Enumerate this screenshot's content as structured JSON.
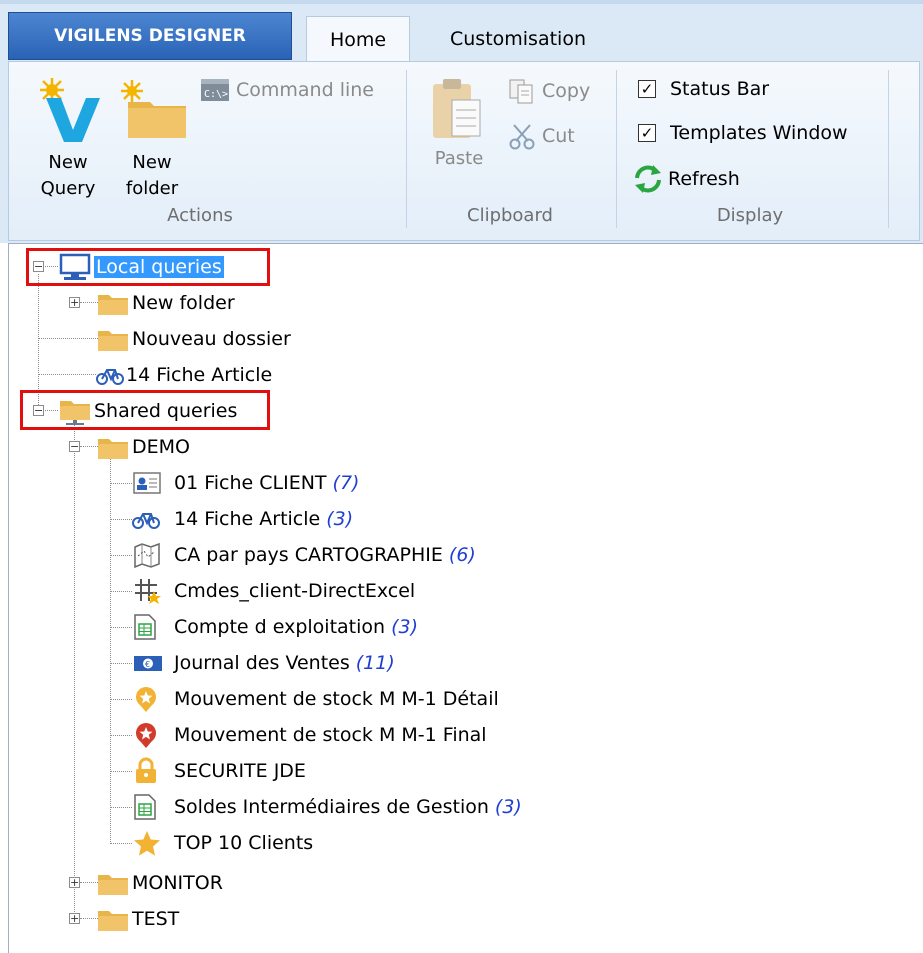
{
  "ribbon": {
    "app_tab": "VIGILENS DESIGNER",
    "tabs": [
      {
        "label": "Home",
        "active": true
      },
      {
        "label": "Customisation",
        "active": false
      }
    ],
    "groups": {
      "actions": {
        "label": "Actions",
        "new_query": "New Query",
        "new_query_line1": "New",
        "new_query_line2": "Query",
        "new_folder_line1": "New",
        "new_folder_line2": "folder",
        "command_line": "Command line"
      },
      "clipboard": {
        "label": "Clipboard",
        "paste": "Paste",
        "copy": "Copy",
        "cut": "Cut"
      },
      "display": {
        "label": "Display",
        "status_bar": "Status Bar",
        "status_bar_checked": true,
        "templates_window": "Templates Window",
        "templates_window_checked": true,
        "refresh": "Refresh"
      }
    }
  },
  "tree": {
    "local": {
      "label": "Local queries",
      "children": [
        "New folder",
        "Nouveau dossier",
        "14 Fiche Article"
      ]
    },
    "shared": {
      "label": "Shared queries",
      "demo": {
        "label": "DEMO",
        "items": [
          {
            "label": "01 Fiche CLIENT",
            "count": "(7)"
          },
          {
            "label": "14 Fiche Article",
            "count": "(3)"
          },
          {
            "label": "CA par pays CARTOGRAPHIE",
            "count": "(6)"
          },
          {
            "label": "Cmdes_client-DirectExcel",
            "count": ""
          },
          {
            "label": "Compte d exploitation",
            "count": "(3)"
          },
          {
            "label": "Journal des Ventes",
            "count": "(11)"
          },
          {
            "label": "Mouvement de stock M M-1 Détail",
            "count": ""
          },
          {
            "label": "Mouvement de stock M M-1 Final",
            "count": ""
          },
          {
            "label": "SECURITE JDE",
            "count": ""
          },
          {
            "label": "Soldes Intermédiaires de Gestion",
            "count": "(3)"
          },
          {
            "label": "TOP 10 Clients",
            "count": ""
          }
        ]
      },
      "monitor": {
        "label": "MONITOR"
      },
      "test": {
        "label": "TEST"
      }
    }
  },
  "colors": {
    "selection": "#3399ff",
    "highlight_box": "#e01010",
    "count_text": "#1f3fd1",
    "folder": "#f2c46a"
  }
}
